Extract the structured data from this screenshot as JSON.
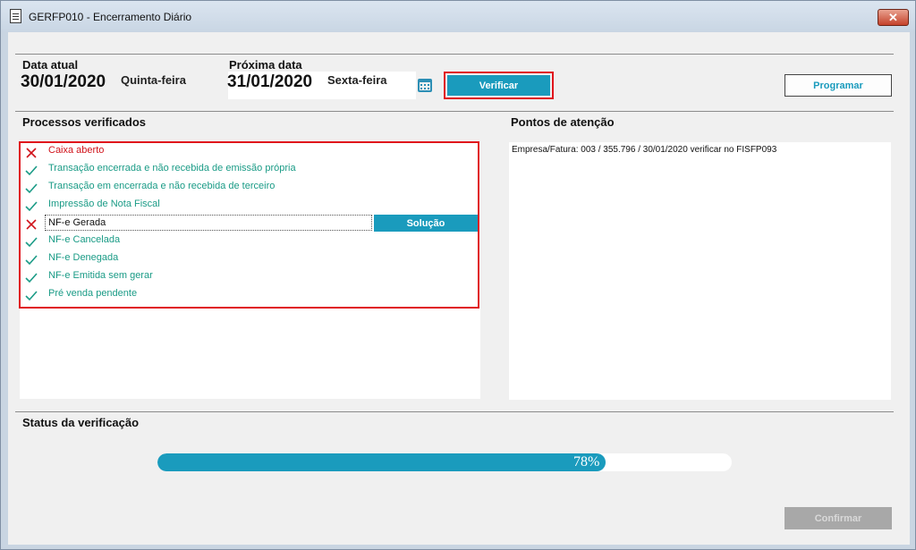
{
  "window": {
    "title": "GERFP010 - Encerramento Diário",
    "close_label": "✕"
  },
  "current": {
    "label": "Data atual",
    "date": "30/01/2020",
    "weekday": "Quinta-feira"
  },
  "next": {
    "label": "Próxima data",
    "date": "31/01/2020",
    "weekday": "Sexta-feira"
  },
  "buttons": {
    "verify": "Verificar",
    "program": "Programar",
    "solution": "Solução",
    "confirm": "Confirmar"
  },
  "processes": {
    "header": "Processos verificados",
    "items": [
      {
        "label": "Caixa aberto",
        "status": "error"
      },
      {
        "label": "Transação encerrada e não recebida de emissão própria",
        "status": "ok"
      },
      {
        "label": "Transação em encerrada e não recebida de terceiro",
        "status": "ok"
      },
      {
        "label": "Impressão de Nota Fiscal",
        "status": "ok"
      },
      {
        "label": "NF-e Gerada",
        "status": "error",
        "selected": true
      },
      {
        "label": "NF-e Cancelada",
        "status": "ok"
      },
      {
        "label": "NF-e Denegada",
        "status": "ok"
      },
      {
        "label": "NF-e Emitida sem gerar",
        "status": "ok"
      },
      {
        "label": "Pré venda pendente",
        "status": "ok"
      }
    ]
  },
  "attention": {
    "header": "Pontos de atenção",
    "text": "Empresa/Fatura: 003 / 355.796 / 30/01/2020 verificar no FISFP093"
  },
  "status": {
    "header": "Status da verificação",
    "progress_percent": 78,
    "progress_text": "78%"
  },
  "colors": {
    "accent": "#1a9bbd",
    "ok": "#1a9b86",
    "error": "#d0121a",
    "highlight": "#e0141c"
  },
  "icons": {
    "ok": "check-icon",
    "error": "x-icon",
    "calendar": "calendar-icon",
    "document": "document-icon"
  }
}
